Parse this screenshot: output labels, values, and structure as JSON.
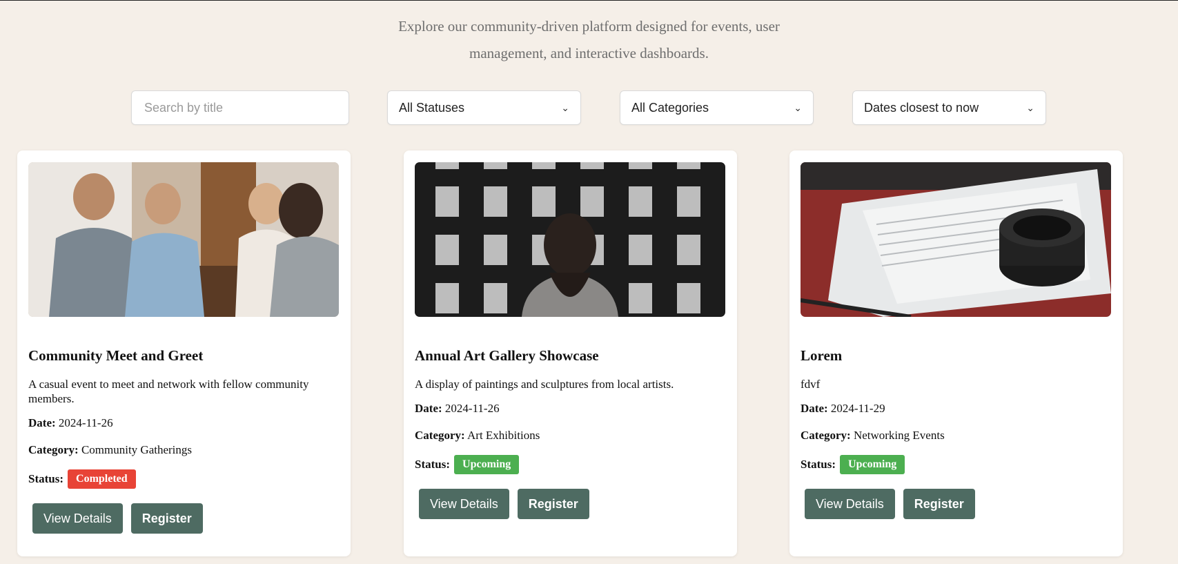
{
  "intro": {
    "text": "Explore our community-driven platform designed for events, user management, and interactive dashboards."
  },
  "filters": {
    "search_placeholder": "Search by title",
    "status_selected": "All Statuses",
    "category_selected": "All Categories",
    "sort_selected": "Dates closest to now"
  },
  "labels": {
    "date": "Date:",
    "category": "Category:",
    "status": "Status:",
    "view_details": "View Details",
    "register": "Register"
  },
  "colors": {
    "background": "#f5efe8",
    "button": "#4e6b62",
    "completed": "#e84336",
    "upcoming": "#4caf50"
  },
  "events": [
    {
      "title": "Community Meet and Greet",
      "description": "A casual event to meet and network with fellow community members.",
      "date": "2024-11-26",
      "category": "Community Gatherings",
      "status": "Completed",
      "image": "people-meeting-photo"
    },
    {
      "title": "Annual Art Gallery Showcase",
      "description": "A display of paintings and sculptures from local artists.",
      "date": "2024-11-26",
      "category": "Art Exhibitions",
      "status": "Upcoming",
      "image": "gallery-wall-photo"
    },
    {
      "title": "Lorem",
      "description": "fdvf",
      "date": "2024-11-29",
      "category": "Networking Events",
      "status": "Upcoming",
      "image": "camera-lens-papers-photo"
    }
  ]
}
